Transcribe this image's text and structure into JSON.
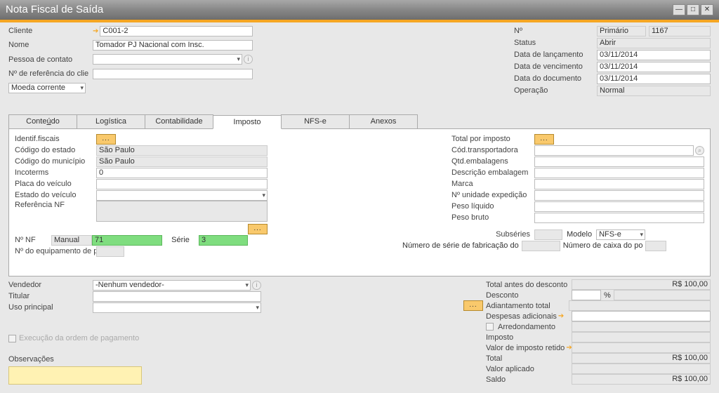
{
  "window": {
    "title": "Nota Fiscal de Saída"
  },
  "header": {
    "cliente_label": "Cliente",
    "cliente_value": "C001-2",
    "nome_label": "Nome",
    "nome_value": "Tomador PJ Nacional com Insc.",
    "pessoa_label": "Pessoa de contato",
    "pessoa_value": "",
    "ref_label": "Nº de referência do clie",
    "ref_value": "",
    "moeda_label": "Moeda corrente",
    "numero_label": "Nº",
    "numero_tipo": "Primário",
    "numero_value": "1167",
    "status_label": "Status",
    "status_value": "Abrir",
    "lanc_label": "Data de lançamento",
    "lanc_value": "03/11/2014",
    "venc_label": "Data de vencimento",
    "venc_value": "03/11/2014",
    "doc_label": "Data do documento",
    "doc_value": "03/11/2014",
    "oper_label": "Operação",
    "oper_value": "Normal"
  },
  "tabs": {
    "conteudo": "Conteúdo",
    "conteudo_underline": "ú",
    "logistica": "Logística",
    "contabilidade": "Contabilidade",
    "imposto": "Imposto",
    "nfse": "NFS-e",
    "anexos": "Anexos"
  },
  "imposto": {
    "identif_label": "Identif.fiscais",
    "estado_label": "Código do estado",
    "estado_value": "São Paulo",
    "municipio_label": "Código do município",
    "municipio_value": "São Paulo",
    "incoterms_label": "Incoterms",
    "incoterms_value": "0",
    "placa_label": "Placa do veículo",
    "placa_value": "",
    "estadov_label": "Estado do veículo",
    "estadov_value": "",
    "refnf_label": "Referência NF",
    "nfnum_label": "Nº NF",
    "nfmanual": "Manual",
    "nfnum_value": "71",
    "serie_label": "Série",
    "serie_value": "3",
    "equip_label": "Nº do equipamento de po",
    "equip_value": "",
    "total_imp_label": "Total por imposto",
    "transp_label": "Cód.transportadora",
    "qtdemb_label": "Qtd.embalagens",
    "descemb_label": "Descrição embalagem",
    "marca_label": "Marca",
    "unid_label": "Nº unidade expedição",
    "pesoliq_label": "Peso líquido",
    "pesobruto_label": "Peso bruto",
    "subseries_label": "Subséries",
    "modelo_label": "Modelo",
    "modelo_value": "NFS-e",
    "numserie_label": "Número de série de fabricação do",
    "numcaixa_label": "Número de caixa do po"
  },
  "vendedor": {
    "vend_label": "Vendedor",
    "vend_value": "-Nenhum vendedor-",
    "titular_label": "Titular",
    "uso_label": "Uso principal",
    "exec_label": "Execução da ordem de pagamento",
    "obs_label": "Observações"
  },
  "totals": {
    "antes_label": "Total antes do desconto",
    "antes_value": "R$ 100,00",
    "desc_label": "Desconto",
    "desc_pct": "%",
    "adiant_label": "Adiantamento total",
    "desp_label": "Despesas adicionais",
    "arred_label": "Arredondamento",
    "imp_label": "Imposto",
    "retido_label": "Valor de imposto retido",
    "total_label": "Total",
    "total_value": "R$ 100,00",
    "aplicado_label": "Valor aplicado",
    "saldo_label": "Saldo",
    "saldo_value": "R$ 100,00"
  }
}
